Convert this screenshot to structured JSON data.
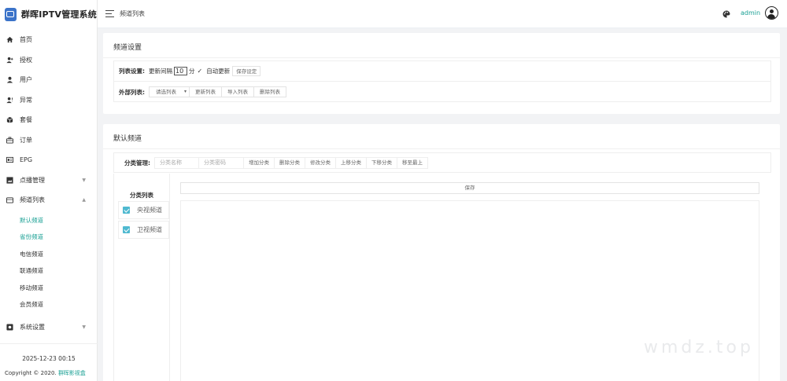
{
  "app": {
    "title": "群晖IPTV管理系统"
  },
  "header": {
    "page_title": "频道列表",
    "user": "admin"
  },
  "sidebar": {
    "items": [
      {
        "label": "首页",
        "icon": "home-icon"
      },
      {
        "label": "授权",
        "icon": "user-add-icon"
      },
      {
        "label": "用户",
        "icon": "user-icon"
      },
      {
        "label": "异常",
        "icon": "user-alert-icon"
      },
      {
        "label": "套餐",
        "icon": "package-icon"
      },
      {
        "label": "订单",
        "icon": "briefcase-icon"
      },
      {
        "label": "EPG",
        "icon": "epg-icon"
      },
      {
        "label": "点播管理",
        "icon": "vod-icon"
      },
      {
        "label": "频道列表",
        "icon": "channel-icon"
      }
    ],
    "channel_sub": [
      {
        "label": "默认频道",
        "active": true
      },
      {
        "label": "省份频道",
        "active": true
      },
      {
        "label": "电信频道",
        "active": false
      },
      {
        "label": "联通频道",
        "active": false
      },
      {
        "label": "移动频道",
        "active": false
      },
      {
        "label": "会员频道",
        "active": false
      }
    ],
    "settings": {
      "label": "系统设置",
      "icon": "settings-icon"
    },
    "footer_time": "2025-12-23 00:15",
    "footer_copy": "Copyright © 2020.",
    "footer_link": "群晖影视盒"
  },
  "channel_settings": {
    "title": "频道设置",
    "list_label": "列表设置:",
    "interval_label": "更新间隔",
    "interval_value": "10",
    "interval_unit": "分",
    "auto_check": "✓",
    "auto_label": "自动更新",
    "save_settings": "保存设定",
    "external_label": "外部列表:",
    "select_placeholder": "请选列表",
    "btn_update": "更新列表",
    "btn_import": "导入列表",
    "btn_delete": "删除列表"
  },
  "default_channel": {
    "title": "默认频道",
    "cat_label": "分类管理:",
    "cat_name_placeholder": "分类名称",
    "cat_pwd_placeholder": "分类密码",
    "buttons": [
      "增加分类",
      "删除分类",
      "修改分类",
      "上移分类",
      "下移分类",
      "移至最上"
    ],
    "tree_title": "分类列表",
    "categories": [
      "央视频道",
      "卫视频道"
    ],
    "save": "保存"
  },
  "colors": {
    "accent": "#1aa094",
    "logo": "#3b73c9",
    "checkbox": "#4fb9d0"
  },
  "watermark": "wmdz.top"
}
